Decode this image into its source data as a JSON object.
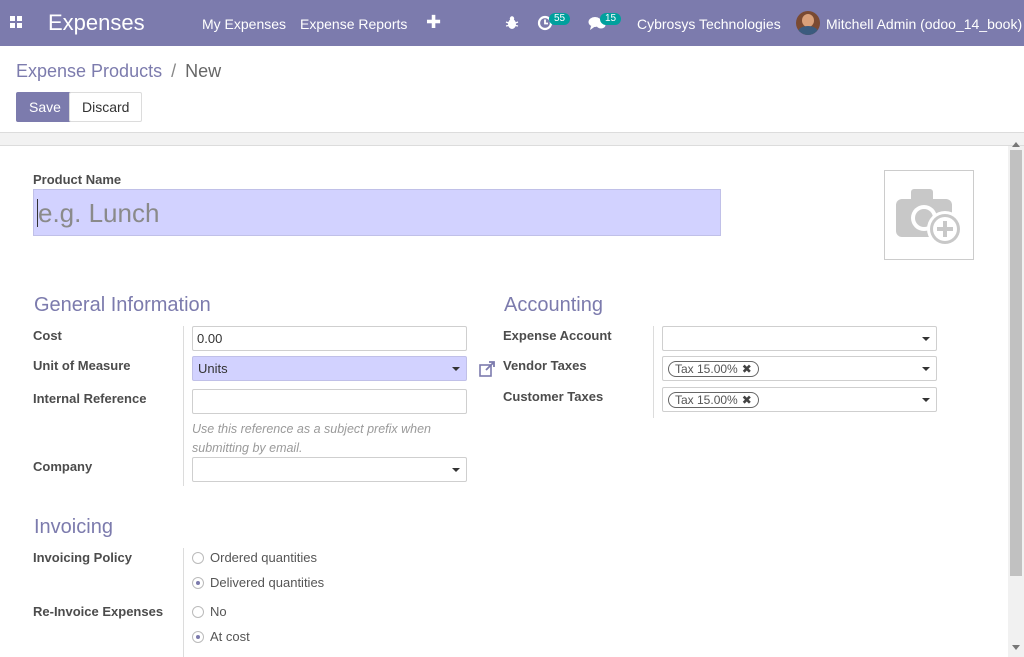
{
  "navbar": {
    "app_title": "Expenses",
    "menu": [
      "My Expenses",
      "Expense Reports"
    ],
    "plus": "✚",
    "activity_count": "55",
    "messages_count": "15",
    "company": "Cybrosys Technologies",
    "user": "Mitchell Admin (odoo_14_book)"
  },
  "breadcrumb": {
    "parent": "Expense Products",
    "separator": "/",
    "current": "New"
  },
  "buttons": {
    "save": "Save",
    "discard": "Discard"
  },
  "form": {
    "product_name_label": "Product Name",
    "product_name_placeholder": "e.g. Lunch",
    "general_information": {
      "title": "General Information",
      "cost_label": "Cost",
      "cost_value": "0.00",
      "uom_label": "Unit of Measure",
      "uom_value": "Units",
      "internal_reference_label": "Internal Reference",
      "internal_reference_value": "",
      "internal_reference_help": "Use this reference as a subject prefix when submitting by email.",
      "company_label": "Company",
      "company_value": ""
    },
    "accounting": {
      "title": "Accounting",
      "expense_account_label": "Expense Account",
      "expense_account_value": "",
      "vendor_taxes_label": "Vendor Taxes",
      "vendor_taxes_tag": "Tax 15.00%",
      "customer_taxes_label": "Customer Taxes",
      "customer_taxes_tag": "Tax 15.00%",
      "tag_remove": "✖"
    },
    "invoicing": {
      "title": "Invoicing",
      "invoicing_policy_label": "Invoicing Policy",
      "invoicing_policy_options": [
        "Ordered quantities",
        "Delivered quantities"
      ],
      "invoicing_policy_selected": "Delivered quantities",
      "reinvoice_label": "Re-Invoice Expenses",
      "reinvoice_options": [
        "No",
        "At cost"
      ],
      "reinvoice_selected": "At cost"
    }
  },
  "colors": {
    "brand": "#7c7bad",
    "badge": "#00a09d",
    "highlight": "#d2d2ff"
  }
}
